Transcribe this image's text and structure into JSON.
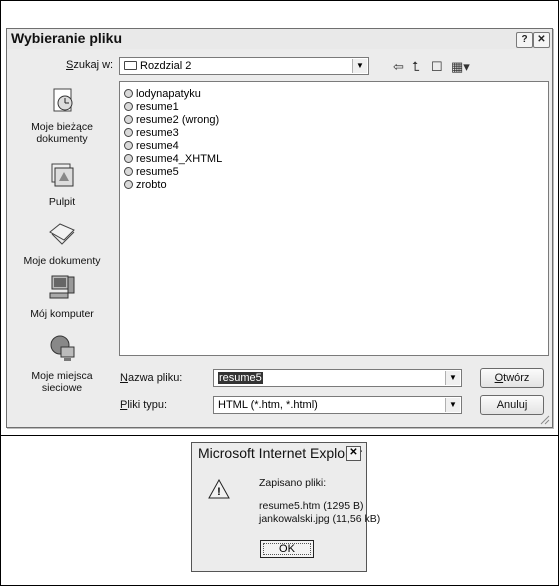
{
  "dialog": {
    "title": "Wybieranie pliku",
    "help_label": "?",
    "close_label": "✕",
    "lookin_label": "Szukaj w:",
    "lookin_value": "Rozdzial 2",
    "places": [
      {
        "label": "Moje bieżące dokumenty",
        "icon": "recent-documents-icon"
      },
      {
        "label": "Pulpit",
        "icon": "desktop-icon"
      },
      {
        "label": "Moje dokumenty",
        "icon": "my-documents-icon"
      },
      {
        "label": "Mój komputer",
        "icon": "my-computer-icon"
      },
      {
        "label": "Moje miejsca sieciowe",
        "icon": "network-places-icon"
      }
    ],
    "files": [
      "lodynapatyku",
      "resume1",
      "resume2 (wrong)",
      "resume3",
      "resume4",
      "resume4_XHTML",
      "resume5",
      "zrobto"
    ],
    "filename_label": "Nazwa pliku:",
    "filename_value": "resume5",
    "filetype_label": "Pliki typu:",
    "filetype_value": "HTML (*.htm, *.html)",
    "open_button": "Otwórz",
    "cancel_button": "Anuluj"
  },
  "alert": {
    "title": "Microsoft Internet Explorer",
    "close_label": "✕",
    "message": "Zapisano pliki:",
    "line1": "resume5.htm (1295 B)",
    "line2": "jankowalski.jpg (11,56 kB)",
    "ok_button": "OK"
  }
}
